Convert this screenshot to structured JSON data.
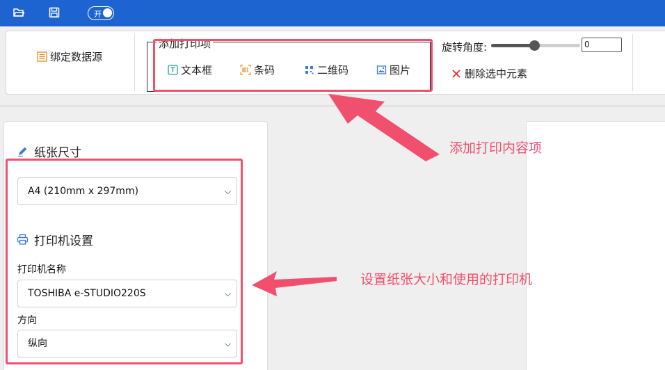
{
  "topbar": {
    "icons": [
      "folder-open-icon",
      "save-icon"
    ],
    "toggle_label": "开"
  },
  "toolbar": {
    "bind_datasource_label": "绑定数据源",
    "add_group_legend": "添加打印项",
    "add_items": [
      {
        "label": "文本框",
        "icon": "textbox-icon"
      },
      {
        "label": "条码",
        "icon": "barcode-icon"
      },
      {
        "label": "二维码",
        "icon": "qrcode-icon"
      },
      {
        "label": "图片",
        "icon": "image-icon"
      }
    ],
    "rotation_label": "旋转角度:",
    "rotation_value": "0",
    "rotation_slider_fraction": 0.5,
    "delete_label": "删除选中元素"
  },
  "left_panel": {
    "paper_size_title": "纸张尺寸",
    "paper_size_value": "A4 (210mm x 297mm)",
    "printer_settings_title": "打印机设置",
    "printer_name_label": "打印机名称",
    "printer_name_value": "TOSHIBA e-STUDIO220S",
    "orientation_label": "方向",
    "orientation_value": "纵向"
  },
  "annotations": {
    "callout_add": "添加打印内容项",
    "callout_paper": "设置纸张大小和使用的打印机",
    "color": "#f0506e"
  },
  "colors": {
    "topbar": "#1e64d0",
    "accent_red": "#f0506e"
  }
}
